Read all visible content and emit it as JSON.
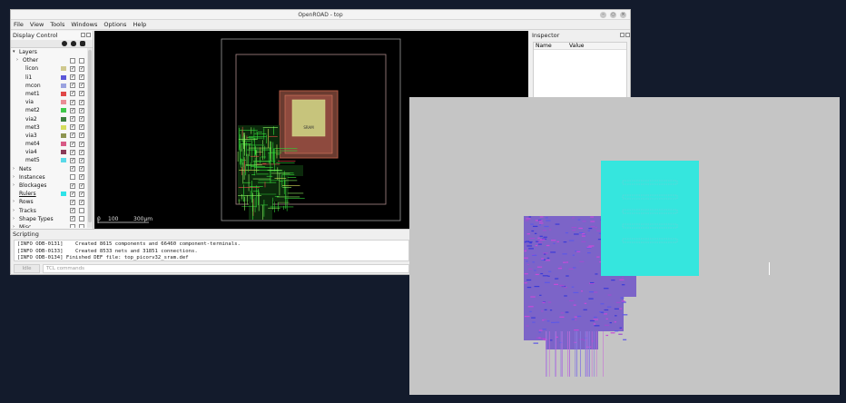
{
  "window": {
    "title": "OpenROAD - top",
    "controls": [
      "–",
      "○",
      "×"
    ]
  },
  "menu": [
    "File",
    "View",
    "Tools",
    "Windows",
    "Options",
    "Help"
  ],
  "display_control": {
    "title": "Display Control",
    "rows": [
      {
        "label": "Layers",
        "expand": "▾",
        "indent": 0
      },
      {
        "label": "Other",
        "expand": "›",
        "indent": 1,
        "cb1": "",
        "cb2": ""
      },
      {
        "label": "licon",
        "indent": 2,
        "color": "#cfc88e",
        "cb1": "✓",
        "cb2": "✓"
      },
      {
        "label": "li1",
        "indent": 2,
        "color": "#5b57d8",
        "cb1": "✓",
        "cb2": "✓"
      },
      {
        "label": "mcon",
        "indent": 2,
        "color": "#9aa2df",
        "cb1": "✓",
        "cb2": "✓"
      },
      {
        "label": "met1",
        "indent": 2,
        "color": "#e04848",
        "cb1": "✓",
        "cb2": "✓"
      },
      {
        "label": "via",
        "indent": 2,
        "color": "#ea8c95",
        "cb1": "✓",
        "cb2": "✓"
      },
      {
        "label": "met2",
        "indent": 2,
        "color": "#3ec94a",
        "cb1": "✓",
        "cb2": "✓"
      },
      {
        "label": "via2",
        "indent": 2,
        "color": "#3b7f3d",
        "cb1": "✓",
        "cb2": "✓"
      },
      {
        "label": "met3",
        "indent": 2,
        "color": "#d5dd5b",
        "cb1": "✓",
        "cb2": "✓"
      },
      {
        "label": "via3",
        "indent": 2,
        "color": "#8d9450",
        "cb1": "✓",
        "cb2": "✓"
      },
      {
        "label": "met4",
        "indent": 2,
        "color": "#d85a86",
        "cb1": "✓",
        "cb2": "✓"
      },
      {
        "label": "via4",
        "indent": 2,
        "color": "#8a3b58",
        "cb1": "✓",
        "cb2": "✓"
      },
      {
        "label": "met5",
        "indent": 2,
        "color": "#5ad9e8",
        "cb1": "✓",
        "cb2": "✓"
      },
      {
        "label": "Nets",
        "expand": "›",
        "indent": 0,
        "cb1": "✓",
        "cb2": "✓"
      },
      {
        "label": "Instances",
        "expand": "›",
        "indent": 0,
        "cb1": "",
        "cb2": "✓"
      },
      {
        "label": "Blockages",
        "expand": "›",
        "indent": 0,
        "cb1": "✓",
        "cb2": "✓"
      },
      {
        "label": "Rulers",
        "indent": 0,
        "color": "#2ee3e8",
        "cb1": "✓",
        "cb2": "✓",
        "underline": true
      },
      {
        "label": "Rows",
        "expand": "›",
        "indent": 0,
        "cb1": "✓",
        "cb2": "✓"
      },
      {
        "label": "Tracks",
        "expand": "›",
        "indent": 0,
        "cb1": "✓",
        "cb2": ""
      },
      {
        "label": "Shape Types",
        "expand": "›",
        "indent": 0,
        "cb1": "✓",
        "cb2": ""
      },
      {
        "label": "Misc",
        "expand": "›",
        "indent": 0,
        "cb1": "",
        "cb2": ""
      }
    ]
  },
  "canvas": {
    "scale_labels": [
      "0",
      "100",
      "300μm"
    ]
  },
  "inspector": {
    "title": "Inspector",
    "columns": [
      "Name",
      "Value"
    ]
  },
  "scripting": {
    "title": "Scripting",
    "log": [
      "[INFO ODB-0131]    Created 8615 components and 66460 component-terminals.",
      "[INFO ODB-0133]    Created 8533 nets and 31851 connections.",
      "[INFO ODB-0134] Finished DEF file: top_picorv32_sram.def"
    ],
    "idle_label": "Idle",
    "input_placeholder": "TCL commands"
  },
  "macro": {
    "label": "SRAM"
  }
}
